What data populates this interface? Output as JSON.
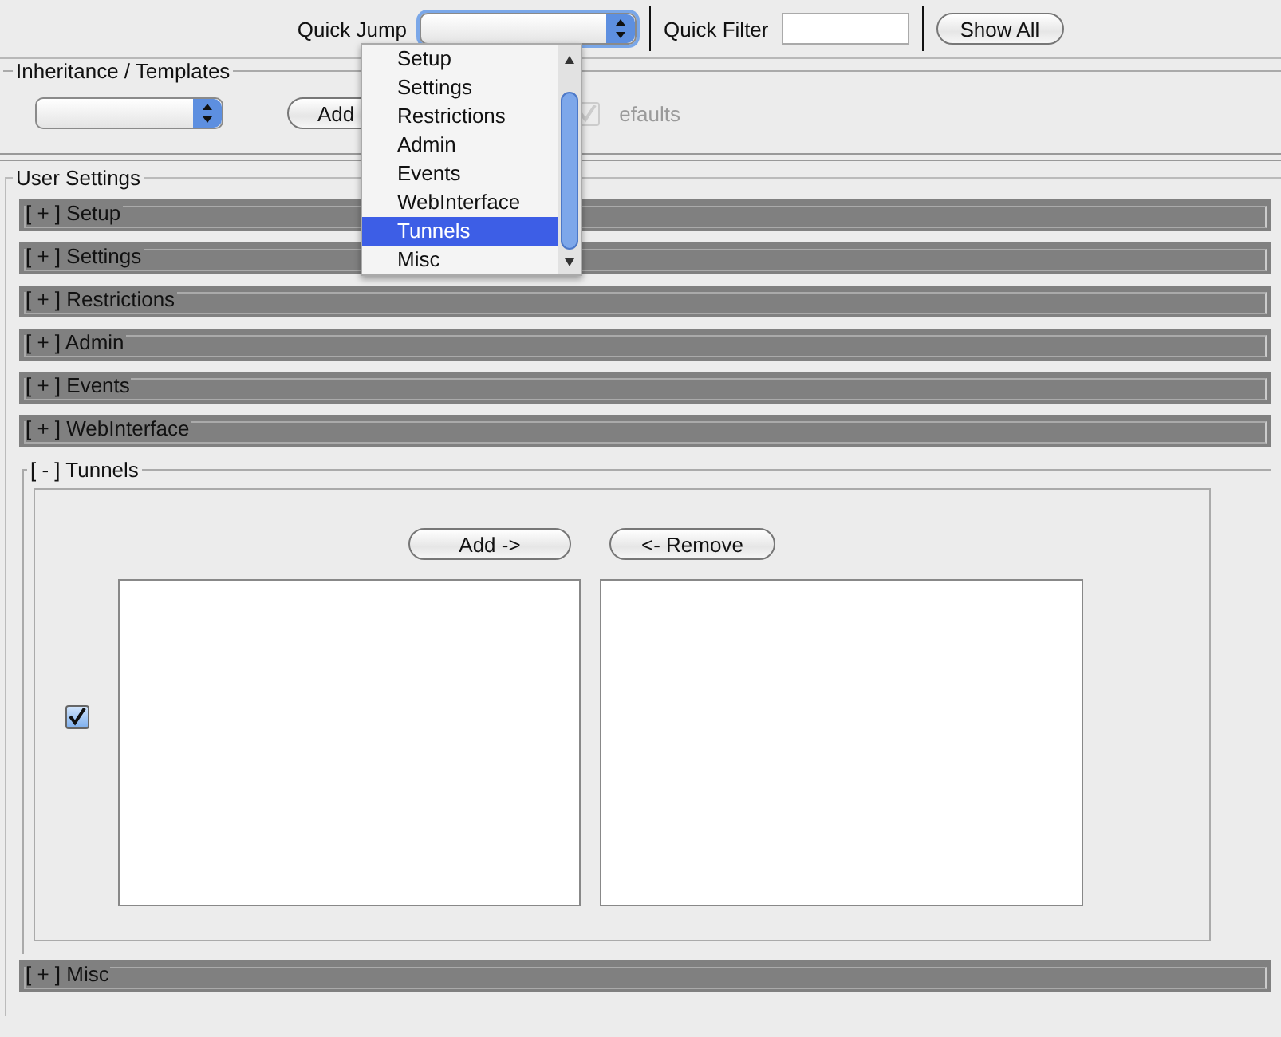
{
  "toolbar": {
    "quick_jump": {
      "label": "Quick Jump",
      "expanded": true,
      "options": [
        {
          "label": "Setup",
          "selected": false
        },
        {
          "label": "Settings",
          "selected": false
        },
        {
          "label": "Restrictions",
          "selected": false
        },
        {
          "label": "Admin",
          "selected": false
        },
        {
          "label": "Events",
          "selected": false
        },
        {
          "label": "WebInterface",
          "selected": false
        },
        {
          "label": "Tunnels",
          "selected": true
        },
        {
          "label": "Misc",
          "selected": false
        }
      ]
    },
    "quick_filter": {
      "label": "Quick Filter"
    },
    "show_all_button": "Show All"
  },
  "inheritance": {
    "title": "Inheritance / Templates",
    "add_button": "Add",
    "defaults": {
      "label": "efaults",
      "checked": true,
      "disabled": true
    }
  },
  "user_settings": {
    "title": "User Settings",
    "sections": [
      {
        "label": "[ + ] Setup",
        "expanded": false
      },
      {
        "label": "[ + ] Settings",
        "expanded": false
      },
      {
        "label": "[ + ] Restrictions",
        "expanded": false
      },
      {
        "label": "[ + ] Admin",
        "expanded": false
      },
      {
        "label": "[ + ] Events",
        "expanded": false
      },
      {
        "label": "[ + ] WebInterface",
        "expanded": false
      },
      {
        "label": "[ - ] Tunnels",
        "expanded": true,
        "add_button": "Add ->",
        "remove_button": "<- Remove",
        "enabled": {
          "checked": true
        }
      },
      {
        "label": "[ + ] Misc",
        "expanded": false
      }
    ]
  }
}
